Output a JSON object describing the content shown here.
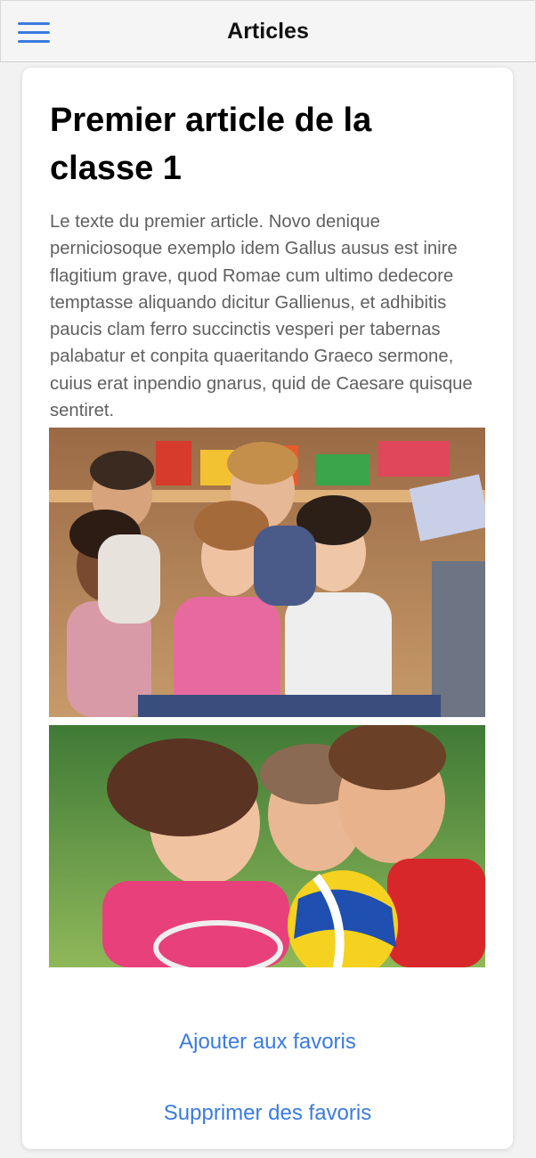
{
  "header": {
    "title": "Articles",
    "menu_icon": "hamburger-menu-icon",
    "accent_color": "#3a7be0"
  },
  "article": {
    "title": "Premier article de la classe 1",
    "body": "Le texte du premier article. Novo denique perniciosoque exemplo idem Gallus ausus est inire flagitium grave, quod Romae cum ultimo dedecore temptasse aliquando dicitur Gallienus, et adhibitis paucis clam ferro succinctis vesperi per tabernas palabatur et conpita quaeritando Graeco sermone, cuius erat inpendio gnarus, quid de Caesare quisque sentiret."
  },
  "actions": {
    "add_favorite": "Ajouter aux favoris",
    "remove_favorite": "Supprimer des favoris"
  }
}
